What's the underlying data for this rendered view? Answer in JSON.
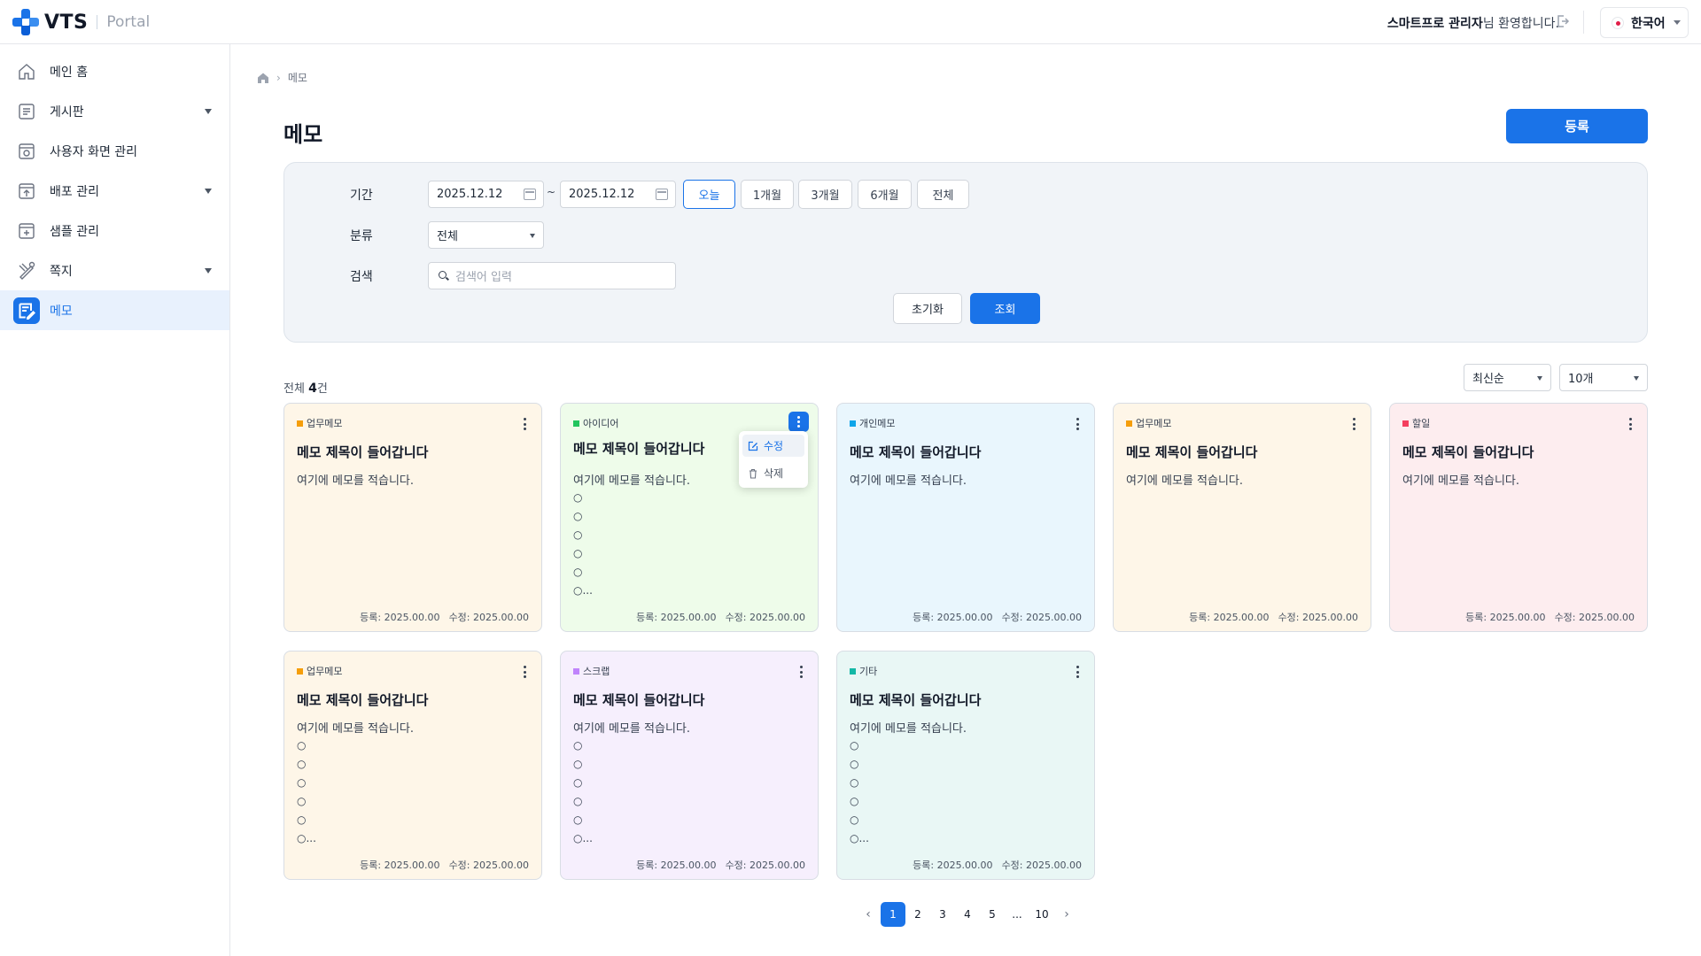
{
  "header": {
    "brand": "VTS",
    "brand_sub": "Portal",
    "welcome_name": "스마트프로 관리자",
    "welcome_suffix": "님 환영합니다.",
    "language": "한국어"
  },
  "sidebar": {
    "items": [
      {
        "label": "메인 홈",
        "icon": "home-icon",
        "expandable": false,
        "active": false
      },
      {
        "label": "게시판",
        "icon": "board-icon",
        "expandable": true,
        "active": false
      },
      {
        "label": "사용자 화면 관리",
        "icon": "screen-manage-icon",
        "expandable": false,
        "active": false
      },
      {
        "label": "배포 관리",
        "icon": "deploy-icon",
        "expandable": true,
        "active": false
      },
      {
        "label": "샘플 관리",
        "icon": "sample-icon",
        "expandable": false,
        "active": false
      },
      {
        "label": "쪽지",
        "icon": "message-icon",
        "expandable": true,
        "active": false
      },
      {
        "label": "메모",
        "icon": "memo-icon",
        "expandable": false,
        "active": true
      }
    ]
  },
  "breadcrumb": {
    "current": "메모"
  },
  "page": {
    "title": "메모",
    "register_label": "등록"
  },
  "filter": {
    "period_label": "기간",
    "date_from": "2025.12.12",
    "date_to": "2025.12.12",
    "tilde": "~",
    "periods": [
      "오늘",
      "1개월",
      "3개월",
      "6개월",
      "전체"
    ],
    "active_period": "오늘",
    "category_label": "분류",
    "category_value": "전체",
    "search_label": "검색",
    "search_placeholder": "검색어 입력",
    "reset_label": "초기화",
    "search_button": "조회"
  },
  "list": {
    "total_prefix": "전체",
    "total_count": "4",
    "total_suffix": "건",
    "sort_value": "최신순",
    "page_size_value": "10개"
  },
  "cards": [
    {
      "tag": "업무메모",
      "tag_color": "#f59e0b",
      "bg": "#fef6e8",
      "title": "메모 제목이 들어갑니다",
      "body": "여기에 메모를 적습니다.",
      "bullets": [],
      "created": "등록: 2025.00.00",
      "modified": "수정: 2025.00.00"
    },
    {
      "tag": "아이디어",
      "tag_color": "#22c55e",
      "bg": "#eefcea",
      "title": "메모 제목이 들어갑니다",
      "body": "여기에 메모를 적습니다.",
      "bullets": [
        "○",
        "○",
        "○",
        "○",
        "○",
        "○..."
      ],
      "created": "등록: 2025.00.00",
      "modified": "수정: 2025.00.00"
    },
    {
      "tag": "개인메모",
      "tag_color": "#0ea5e9",
      "bg": "#e9f6fd",
      "title": "메모 제목이 들어갑니다",
      "body": "여기에 메모를 적습니다.",
      "bullets": [],
      "created": "등록: 2025.00.00",
      "modified": "수정: 2025.00.00"
    },
    {
      "tag": "업무메모",
      "tag_color": "#f59e0b",
      "bg": "#fef6e8",
      "title": "메모 제목이 들어갑니다",
      "body": "여기에 메모를 적습니다.",
      "bullets": [],
      "created": "등록: 2025.00.00",
      "modified": "수정: 2025.00.00"
    },
    {
      "tag": "할일",
      "tag_color": "#f43f5e",
      "bg": "#fdedef",
      "title": "메모 제목이 들어갑니다",
      "body": "여기에 메모를 적습니다.",
      "bullets": [],
      "created": "등록: 2025.00.00",
      "modified": "수정: 2025.00.00"
    },
    {
      "tag": "업무메모",
      "tag_color": "#f59e0b",
      "bg": "#fef6e8",
      "title": "메모 제목이 들어갑니다",
      "body": "여기에 메모를 적습니다.",
      "bullets": [
        "○",
        "○",
        "○",
        "○",
        "○",
        "○..."
      ],
      "created": "등록: 2025.00.00",
      "modified": "수정: 2025.00.00"
    },
    {
      "tag": "스크랩",
      "tag_color": "#c084fc",
      "bg": "#f6effd",
      "title": "메모 제목이 들어갑니다",
      "body": "여기에 메모를 적습니다.",
      "bullets": [
        "○",
        "○",
        "○",
        "○",
        "○",
        "○..."
      ],
      "created": "등록: 2025.00.00",
      "modified": "수정: 2025.00.00"
    },
    {
      "tag": "기타",
      "tag_color": "#14b8a6",
      "bg": "#e9f7f5",
      "title": "메모 제목이 들어갑니다",
      "body": "여기에 메모를 적습니다.",
      "bullets": [
        "○",
        "○",
        "○",
        "○",
        "○",
        "○..."
      ],
      "created": "등록: 2025.00.00",
      "modified": "수정: 2025.00.00"
    }
  ],
  "card_menu": {
    "edit_label": "수정",
    "delete_label": "삭제"
  },
  "pagination": {
    "prev": "‹",
    "pages": [
      "1",
      "2",
      "3",
      "4",
      "5",
      "...",
      "10"
    ],
    "active": "1",
    "next": "›"
  }
}
